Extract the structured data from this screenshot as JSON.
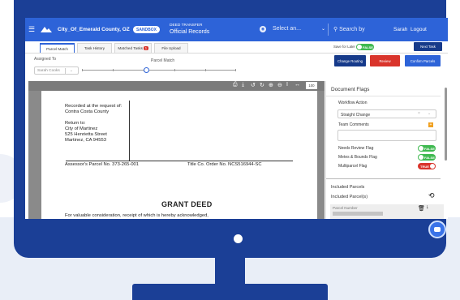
{
  "header": {
    "org": "City_Of_Emerald County, OZ",
    "env_badge": "SANDBOX",
    "subtitle_top": "DEED TRANSFER",
    "subtitle_main": "Official Records",
    "select_placeholder": "Select an...",
    "search_placeholder": "Search by",
    "user_name": "Sarah",
    "logout": "Logout"
  },
  "tabs": [
    {
      "label": "Parcel Match"
    },
    {
      "label": "Task History"
    },
    {
      "label": "Matched Tasks",
      "badge": "1"
    },
    {
      "label": "File Upload"
    }
  ],
  "save_for_later": {
    "label": "Save for Later",
    "toggle": "FALSE"
  },
  "next_task_label": "Next Task",
  "filters": {
    "assigned_label": "Assigned To",
    "assigned_value": "Sarah Cooks",
    "parcel_match_label": "Parcel Match",
    "slider_level": 0.05
  },
  "actions": {
    "change_routing": "Change Routing",
    "review": "Review",
    "confirm_parcels": "Confirm Parcels"
  },
  "viewer": {
    "zoom": "100"
  },
  "document": {
    "recorded": "Recorded at the request of:",
    "county": "Contra Costa County",
    "return_to": "Return to:",
    "city": "City of Martinez",
    "street": "525 Henrietta Street",
    "citystate": "Martinez, CA 94553",
    "assessor": "Assessor's Parcel No. 373-265-001",
    "title_order": "Title Co. Order No. NCS516944-SC",
    "grant": "GRANT DEED",
    "consideration": "For valuable consideration, receipt of which is hereby acknowledged,"
  },
  "flags": {
    "title": "Document Flags",
    "workflow_label": "Workflow Action",
    "workflow_value": "Straight Change",
    "comments_label": "Team Comments",
    "needs_review": {
      "label": "Needs Review Flag",
      "value": "FALSE"
    },
    "metes": {
      "label": "Metes & Bounds Flag",
      "value": "FALSE"
    },
    "multiparcel": {
      "label": "Multiparcel Flag",
      "value": "TRUE"
    }
  },
  "parcels": {
    "title": "Included Parcels",
    "sub": "Included Parcel(s)",
    "col_parcel_number": "Parcel Number"
  },
  "colors": {
    "topbar": "#2d63d8",
    "monitor": "#1b3f96",
    "review": "#d9342b",
    "toggle_false": "#3fb950",
    "toggle_true": "#d9342b"
  }
}
